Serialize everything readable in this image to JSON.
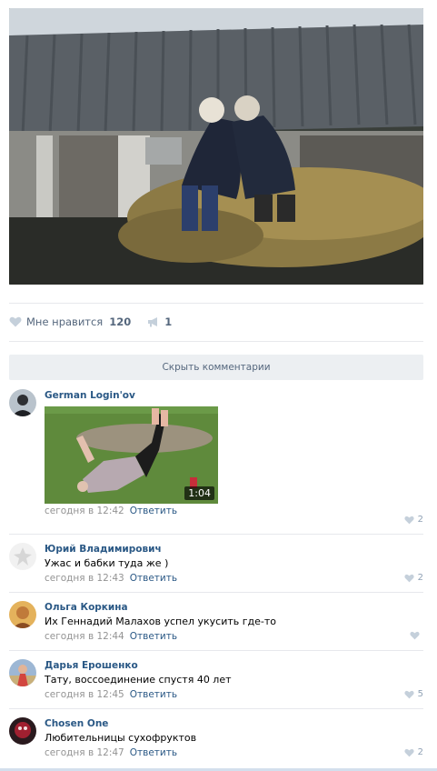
{
  "post": {
    "photo_icon": "photo-grandmothers-haystack",
    "likes_label": "Мне нравится",
    "likes_count": "120",
    "shares_count": "1"
  },
  "comments_toggle": {
    "label": "Скрыть комментарии"
  },
  "comments": [
    {
      "author": "German Login'ov",
      "text": "",
      "has_video": true,
      "video_duration": "1:04",
      "time": "сегодня в 12:42",
      "reply": "Ответить",
      "likes": "2",
      "avatar_color": "#3b3f4a"
    },
    {
      "author": "Юрий Владимирович",
      "text": "Ужас и бабки туда же )",
      "time": "сегодня в 12:43",
      "reply": "Ответить",
      "likes": "2",
      "avatar_color": "#e9e9e9"
    },
    {
      "author": "Ольга Коркина",
      "text": "Их Геннадий Малахов успел укусить где-то",
      "time": "сегодня в 12:44",
      "reply": "Ответить",
      "likes": "",
      "avatar_color": "#c07a3a"
    },
    {
      "author": "Дарья Ерошенко",
      "text": "Тату, воссоединение спустя 40 лет",
      "time": "сегодня в 12:45",
      "reply": "Ответить",
      "likes": "5",
      "avatar_color": "#7a9a6a"
    },
    {
      "author": "Chosen One",
      "text": "Любительницы сухофруктов",
      "time": "сегодня в 12:47",
      "reply": "Ответить",
      "likes": "2",
      "avatar_color": "#a02030"
    }
  ],
  "colors": {
    "link": "#2a5885",
    "meta": "#939393",
    "accent": "#5181b8",
    "divider": "#e7e8ec"
  }
}
